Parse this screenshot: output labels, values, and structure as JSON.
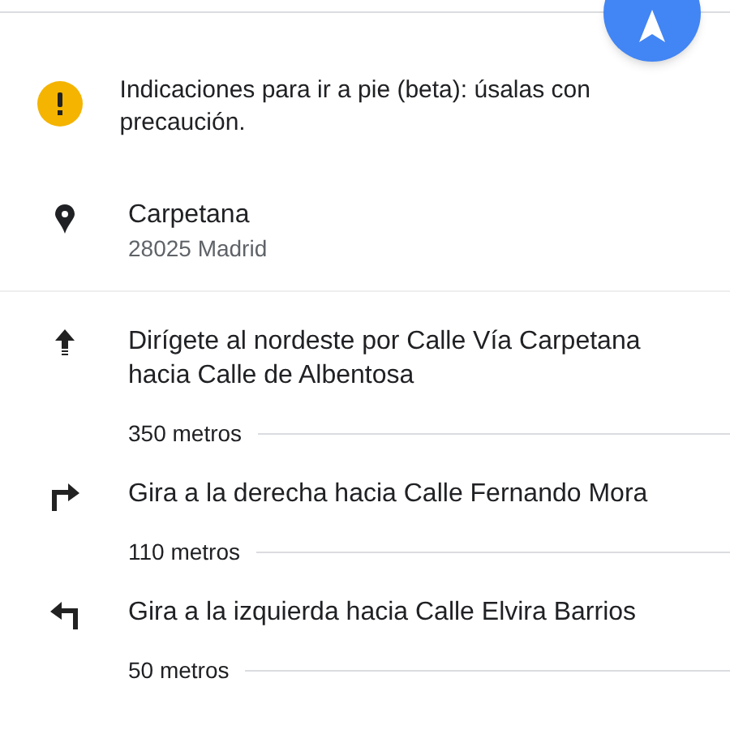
{
  "notice": {
    "text": "Indicaciones para ir a pie (beta): úsalas con precaución."
  },
  "origin": {
    "name": "Carpetana",
    "address": "28025 Madrid"
  },
  "steps": [
    {
      "kind": "straight",
      "instruction": "Dirígete al nordeste por Calle Vía Carpetana hacia Calle de Albentosa",
      "distance": "350 metros"
    },
    {
      "kind": "right",
      "instruction": "Gira a la derecha hacia Calle Fernando Mora",
      "distance": "110 metros"
    },
    {
      "kind": "left",
      "instruction": "Gira a la izquierda hacia Calle Elvira Barrios",
      "distance": "50 metros"
    }
  ]
}
